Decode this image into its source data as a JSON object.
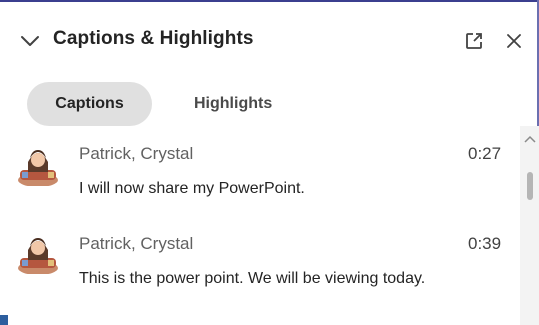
{
  "panel": {
    "title": "Captions & Highlights"
  },
  "tabs": [
    {
      "label": "Captions",
      "active": true
    },
    {
      "label": "Highlights",
      "active": false
    }
  ],
  "captions": [
    {
      "speaker": "Patrick, Crystal",
      "time": "0:27",
      "text": "I will now share my PowerPoint."
    },
    {
      "speaker": "Patrick, Crystal",
      "time": "0:39",
      "text": "This is the power point. We will be viewing today."
    }
  ],
  "icons": {
    "collapse": "chevron-down-icon",
    "popout": "pop-out-icon",
    "close": "close-icon",
    "avatar": "avatar-icon",
    "scroll_up": "chevron-up-icon"
  },
  "colors": {
    "accent": "#3b3f8f",
    "active_tab_bg": "#e0e0e0",
    "text_primary": "#242424",
    "text_secondary": "#616161"
  }
}
